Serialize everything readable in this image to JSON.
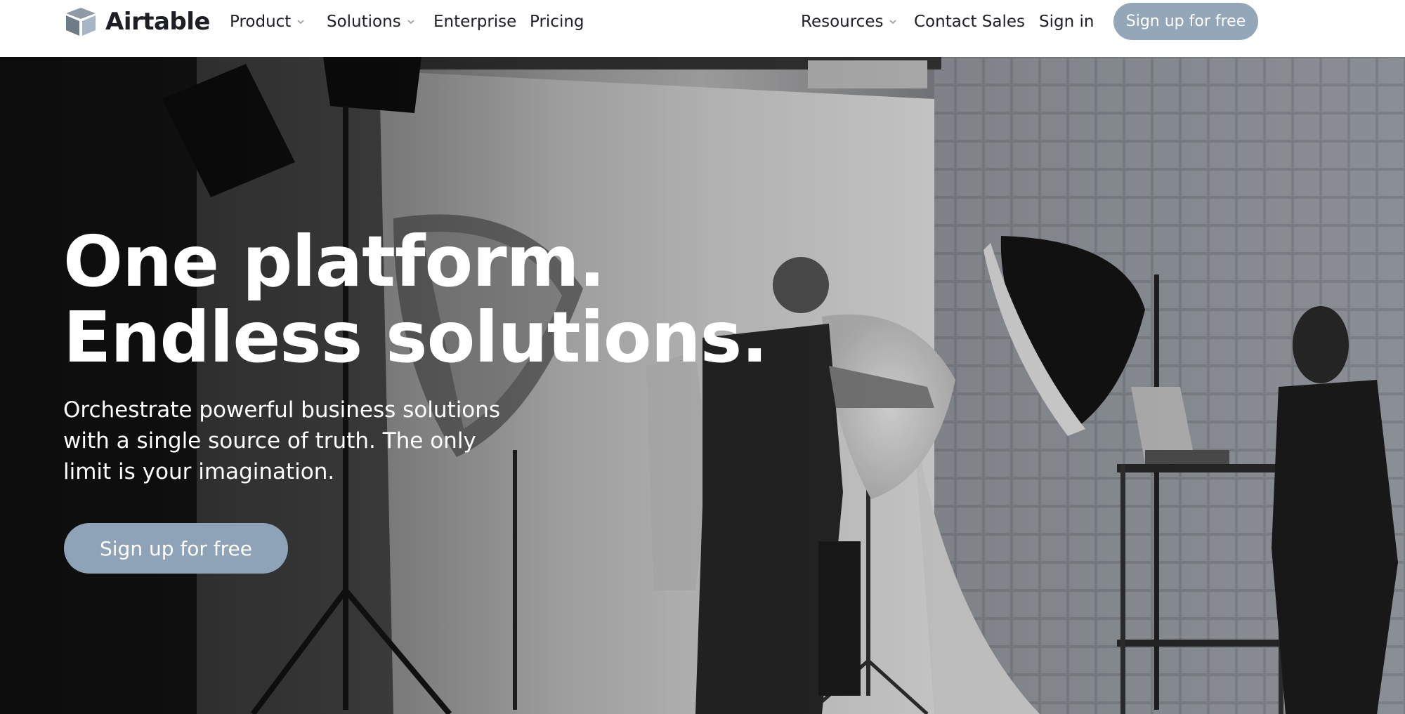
{
  "brand": {
    "name": "Airtable",
    "logo_icon": "airtable-cube-logo"
  },
  "nav": {
    "left_items": [
      {
        "label": "Product",
        "has_dropdown": true
      },
      {
        "label": "Solutions",
        "has_dropdown": true
      },
      {
        "label": "Enterprise",
        "has_dropdown": false
      },
      {
        "label": "Pricing",
        "has_dropdown": false
      }
    ],
    "right_items": [
      {
        "label": "Resources",
        "has_dropdown": true
      },
      {
        "label": "Contact Sales",
        "has_dropdown": false
      },
      {
        "label": "Sign in",
        "has_dropdown": false
      }
    ],
    "cta_label": "Sign up for free"
  },
  "hero": {
    "headline_line1": "One platform.",
    "headline_line2": "Endless solutions.",
    "subtext": "Orchestrate powerful business solutions with a single source of truth. The only limit is your imagination.",
    "cta_label": "Sign up for free",
    "background_image": "black-and-white photo studio scene with lighting equipment and people"
  },
  "colors": {
    "accent": "#93a7b9",
    "text_dark": "#1d1f25",
    "hero_text": "#ffffff"
  }
}
